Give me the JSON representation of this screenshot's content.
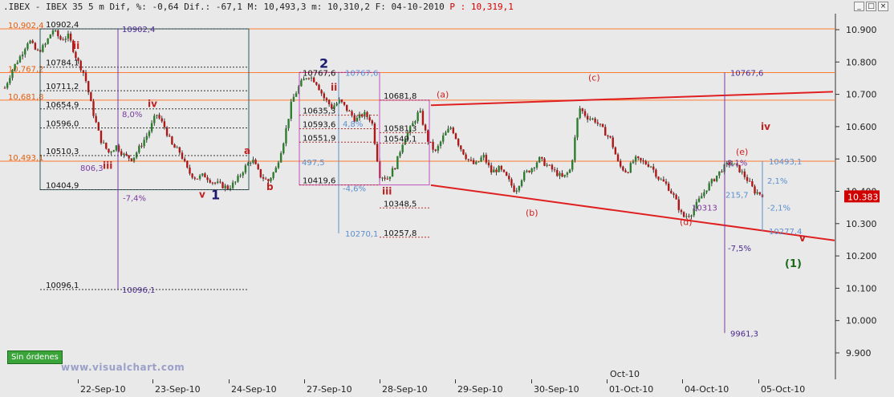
{
  "title_bar": {
    "symbol": ".IBEX - IBEX 35",
    "timeframe": "5 m",
    "dif_pct": "Dif, %: -0,64",
    "dif": "Dif.: -67,1",
    "max": "M: 10,493,3",
    "min": "m: 10,310,2",
    "date": "F: 04-10-2010",
    "price": "P : 10,319,1"
  },
  "window_buttons": [
    "_",
    "□",
    "×"
  ],
  "order_button": "Sin órdenes",
  "watermark": "www.visualchart.com",
  "colors": {
    "up": "#2e7d2e",
    "down": "#b01818",
    "fib": "#7a3aa0",
    "trend": "#e02020",
    "hline": "#ff7a30",
    "blue": "#5c8fd0"
  },
  "chart_data": {
    "type": "candlestick",
    "ylim": [
      9880,
      10940
    ],
    "y_ticks": [
      "10.900",
      "10.800",
      "10.700",
      "10.600",
      "10.500",
      "10.400",
      "10.300",
      "10.200",
      "10.100",
      "10.000",
      "9.900"
    ],
    "last_price_tag": "10.383",
    "x_ticks": [
      "22-Sep-10",
      "23-Sep-10",
      "24-Sep-10",
      "27-Sep-10",
      "28-Sep-10",
      "29-Sep-10",
      "30-Sep-10",
      "01-Oct-10",
      "04-Oct-10",
      "05-Oct-10"
    ],
    "x_top_label": "Oct-10",
    "horizontal_levels": [
      {
        "value": 10902.4,
        "label": "10,902,4"
      },
      {
        "value": 10767.2,
        "label": "10,767,2"
      },
      {
        "value": 10681.8,
        "label": "10,681,8"
      },
      {
        "value": 10493.1,
        "label": "10,493,1"
      }
    ],
    "fib_box1": {
      "levels": [
        "10902,4",
        "10784,1",
        "10711,2",
        "10654,9",
        "10596,0",
        "10510,3",
        "10404,9"
      ],
      "range_label": "806,3",
      "pct_label": "8,0%"
    },
    "fib_box2": {
      "levels": [
        "10767,6",
        "10635,3",
        "10593,6",
        "10551,9",
        "10419,6"
      ],
      "range_label": "497,5",
      "pct_label": "4,8%",
      "pct_down": "-4,6%"
    },
    "fib_box3": {
      "levels": [
        "10681,8",
        "10581,3",
        "10549,1",
        "10348,5",
        "10257,8"
      ]
    },
    "projection_labels": {
      "p1_top": "10902,4",
      "p1_bottom": "10096,1",
      "p1_bottom_left": "10096,1",
      "p1_pct": "-7,4%",
      "p2_top": "10767,6",
      "p2_bottom": "10270,1",
      "p3_top": "10767,6",
      "p3_bottom": "9961,3",
      "p3_pct": "-7,5%",
      "p4_top": "10493,1",
      "p4_bottom": "10277,4",
      "p4_pct_up": "2,1%",
      "p4_pct_down": "-2,1%",
      "p4_range": "215,7",
      "p4_pct_box": "8,1%",
      "p4_low": "10313"
    },
    "wave_labels": {
      "ii_1": "ii",
      "iii_1": "iii",
      "iv_1": "iv",
      "v_1": "v",
      "w1": "1",
      "a1": "a",
      "b1": "b",
      "w2": "2",
      "ii_2": "ii",
      "iii_2": "iii",
      "wa": "(a)",
      "wb": "(b)",
      "wc": "(c)",
      "wd": "(d)",
      "we": "(e)",
      "iv_2": "iv",
      "v_2": "v",
      "w1_paren": "(1)"
    },
    "candles_rough_path": [
      [
        0,
        10720
      ],
      [
        3,
        10780
      ],
      [
        6,
        10820
      ],
      [
        9,
        10870
      ],
      [
        12,
        10830
      ],
      [
        15,
        10850
      ],
      [
        18,
        10900
      ],
      [
        21,
        10870
      ],
      [
        24,
        10880
      ],
      [
        27,
        10810
      ],
      [
        30,
        10760
      ],
      [
        33,
        10650
      ],
      [
        36,
        10560
      ],
      [
        39,
        10520
      ],
      [
        42,
        10540
      ],
      [
        45,
        10510
      ],
      [
        48,
        10500
      ],
      [
        51,
        10540
      ],
      [
        54,
        10580
      ],
      [
        57,
        10640
      ],
      [
        60,
        10600
      ],
      [
        63,
        10540
      ],
      [
        66,
        10520
      ],
      [
        69,
        10460
      ],
      [
        72,
        10440
      ],
      [
        75,
        10450
      ],
      [
        78,
        10430
      ],
      [
        81,
        10420
      ],
      [
        84,
        10410
      ],
      [
        87,
        10430
      ],
      [
        90,
        10470
      ],
      [
        93,
        10500
      ],
      [
        96,
        10450
      ],
      [
        99,
        10430
      ],
      [
        102,
        10470
      ],
      [
        105,
        10560
      ],
      [
        108,
        10680
      ],
      [
        111,
        10730
      ],
      [
        114,
        10760
      ],
      [
        117,
        10740
      ],
      [
        120,
        10690
      ],
      [
        123,
        10660
      ],
      [
        126,
        10680
      ],
      [
        129,
        10650
      ],
      [
        132,
        10620
      ],
      [
        135,
        10640
      ],
      [
        138,
        10620
      ],
      [
        141,
        10450
      ],
      [
        144,
        10440
      ],
      [
        147,
        10480
      ],
      [
        150,
        10560
      ],
      [
        153,
        10600
      ],
      [
        156,
        10650
      ],
      [
        159,
        10560
      ],
      [
        162,
        10520
      ],
      [
        165,
        10570
      ],
      [
        168,
        10600
      ],
      [
        171,
        10540
      ],
      [
        174,
        10500
      ],
      [
        177,
        10480
      ],
      [
        180,
        10510
      ],
      [
        183,
        10460
      ],
      [
        186,
        10470
      ],
      [
        189,
        10440
      ],
      [
        192,
        10400
      ],
      [
        195,
        10450
      ],
      [
        198,
        10470
      ],
      [
        201,
        10500
      ],
      [
        204,
        10480
      ],
      [
        207,
        10460
      ],
      [
        210,
        10440
      ],
      [
        213,
        10470
      ],
      [
        216,
        10660
      ],
      [
        219,
        10630
      ],
      [
        222,
        10620
      ],
      [
        225,
        10590
      ],
      [
        228,
        10560
      ],
      [
        231,
        10480
      ],
      [
        234,
        10460
      ],
      [
        237,
        10500
      ],
      [
        240,
        10490
      ],
      [
        243,
        10480
      ],
      [
        246,
        10440
      ],
      [
        249,
        10420
      ],
      [
        252,
        10380
      ],
      [
        255,
        10320
      ],
      [
        258,
        10330
      ],
      [
        261,
        10370
      ],
      [
        264,
        10410
      ],
      [
        267,
        10440
      ],
      [
        270,
        10470
      ],
      [
        273,
        10490
      ],
      [
        276,
        10470
      ],
      [
        279,
        10440
      ],
      [
        282,
        10400
      ],
      [
        285,
        10390
      ]
    ]
  }
}
